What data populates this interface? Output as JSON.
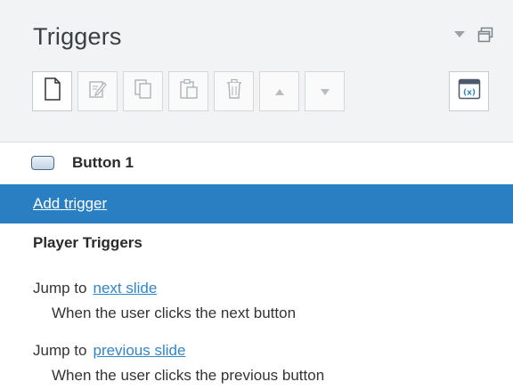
{
  "panel": {
    "title": "Triggers",
    "header_icons": [
      "dropdown-arrow-icon",
      "restore-window-icon"
    ]
  },
  "toolbar": {
    "buttons": [
      {
        "name": "new-trigger-button",
        "icon": "new-page-icon"
      },
      {
        "name": "edit-trigger-button",
        "icon": "edit-pencil-icon"
      },
      {
        "name": "copy-trigger-button",
        "icon": "copy-icon"
      },
      {
        "name": "paste-trigger-button",
        "icon": "paste-icon"
      },
      {
        "name": "delete-trigger-button",
        "icon": "trash-icon"
      },
      {
        "name": "move-up-button",
        "icon": "arrow-up-icon"
      },
      {
        "name": "move-down-button",
        "icon": "arrow-down-icon"
      }
    ],
    "variables_icon": "variables-x-icon",
    "variables_text": "(x)"
  },
  "object": {
    "name": "Button 1",
    "icon": "button-shape-icon"
  },
  "add_trigger": {
    "label": "Add trigger"
  },
  "player_triggers": {
    "title": "Player Triggers",
    "items": [
      {
        "action": "Jump to",
        "target": "next slide",
        "condition": "When the user clicks the next button"
      },
      {
        "action": "Jump to",
        "target": "previous slide",
        "condition": "When the user clicks the previous button"
      }
    ]
  },
  "colors": {
    "selected_row": "#2a7fc3",
    "link": "#2f86c8",
    "header_bg": "#f1f3f5"
  }
}
